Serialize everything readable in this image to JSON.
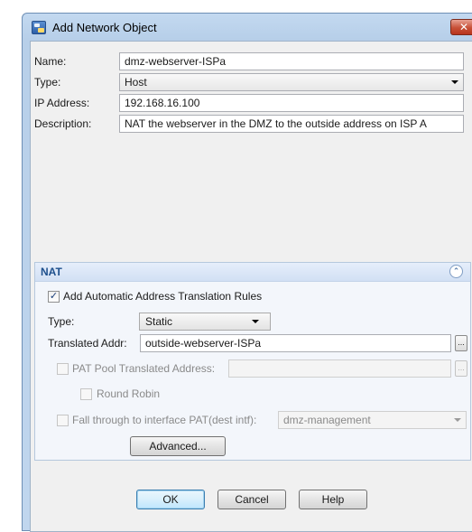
{
  "window": {
    "title": "Add Network Object",
    "close_glyph": "✕"
  },
  "form": {
    "name_label": "Name:",
    "name_value": "dmz-webserver-ISPa",
    "type_label": "Type:",
    "type_value": "Host",
    "ip_label": "IP Address:",
    "ip_value": "192.168.16.100",
    "description_label": "Description:",
    "description_value": "NAT the webserver in the DMZ to the outside address on ISP A"
  },
  "nat": {
    "title": "NAT",
    "collapse_glyph": "⌃",
    "add_rules_label": "Add Automatic Address Translation Rules",
    "add_rules_checked": true,
    "type_label": "Type:",
    "type_value": "Static",
    "translated_label": "Translated Addr:",
    "translated_value": "outside-webserver-ISPa",
    "pat_pool_label": "PAT Pool Translated Address:",
    "pat_pool_value": "",
    "round_robin_label": "Round Robin",
    "fall_through_label": "Fall through to interface PAT(dest intf):",
    "fall_through_value": "dmz-management",
    "advanced_label": "Advanced...",
    "ellipsis": "..."
  },
  "buttons": {
    "ok": "OK",
    "cancel": "Cancel",
    "help": "Help"
  }
}
